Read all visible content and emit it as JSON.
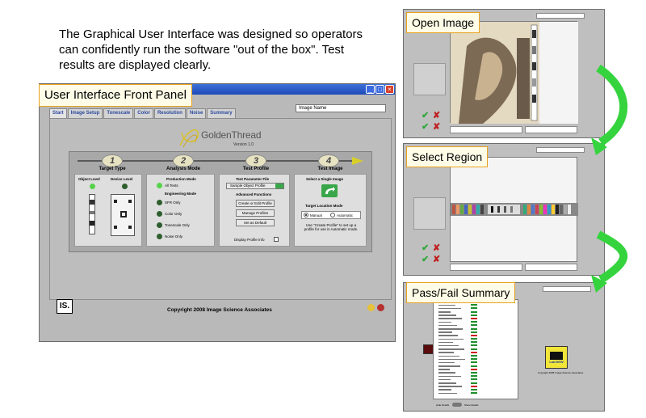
{
  "intro_text": "The Graphical User Interface was designed so operators can confidently run the software \"out of the box\".  Test results are displayed clearly.",
  "main_panel": {
    "callout": "User Interface Front Panel",
    "tabs": [
      "Start",
      "Image Setup",
      "Tonescale",
      "Color",
      "Resolution",
      "Noise",
      "Summary"
    ],
    "image_name_label": "Image Name",
    "logo_text": "GoldenThread",
    "version": "Version 1.0",
    "steps": [
      {
        "num": "1",
        "title": "Target Type"
      },
      {
        "num": "2",
        "title": "Analysis Mode"
      },
      {
        "num": "3",
        "title": "Test Profile"
      },
      {
        "num": "4",
        "title": "Test Image"
      }
    ],
    "target": {
      "object_level": "Object Level",
      "device_level": "Device Level"
    },
    "analysis": {
      "production_mode": "Production Mode",
      "all_tests": "All Tests",
      "engineering_mode": "Engineering Mode",
      "options": [
        "SFR Only",
        "Color Only",
        "Tonescale Only",
        "Noise Only"
      ]
    },
    "profile": {
      "param_file_label": "Test Parameter File",
      "param_file_value": "Sample Object Profile",
      "advanced": "Advanced Functions",
      "buttons": [
        "Create or Edit Profile",
        "Manage Profiles",
        "Set as Default"
      ],
      "display_info": "Display Profile Info"
    },
    "test_image": {
      "select_label": "Select a Single Image",
      "location_mode": "Target Location Mode",
      "manual": "Manual",
      "automatic": "Automatic",
      "hint": "Use \"Create Profile\" to set up a profile for use in Automatic mode."
    },
    "isa_logo": "IS.",
    "copyright": "Copyright 2008 Image Science Associates"
  },
  "thumbs": [
    {
      "title": "Open Image"
    },
    {
      "title": "Select Region"
    },
    {
      "title": "Pass/Fail Summary"
    }
  ],
  "summary": {
    "labview_text": "LabVIEW",
    "copyright_small": "Copyright 2008 Image Science Associates",
    "display_ok": "Hide Details",
    "show_details": "Show Details"
  },
  "colors": {
    "accent_green": "#35d43e",
    "callout_border": "#e8a21f",
    "arrow_yellow": "#d8cf2a"
  }
}
